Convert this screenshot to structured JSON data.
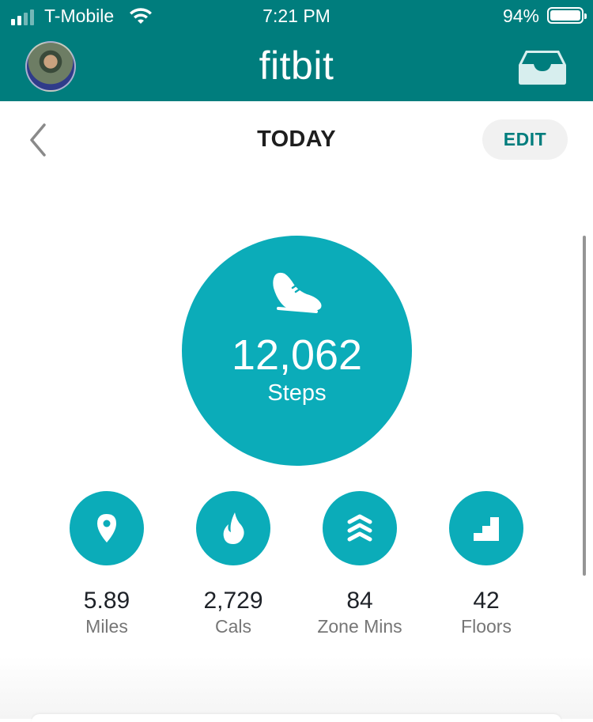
{
  "status_bar": {
    "carrier": "T-Mobile",
    "time": "7:21 PM",
    "battery": "94%",
    "icons": [
      "signal-icon",
      "wifi-icon",
      "battery-icon"
    ]
  },
  "header": {
    "logo": "fitbit",
    "icons": [
      "avatar",
      "inbox-icon"
    ]
  },
  "nav": {
    "title": "TODAY",
    "edit_label": "EDIT",
    "back_icon": "chevron-left-icon"
  },
  "steps": {
    "value": "12,062",
    "label": "Steps",
    "icon": "shoe-icon"
  },
  "stats": [
    {
      "value": "5.89",
      "label": "Miles",
      "icon": "location-pin-icon"
    },
    {
      "value": "2,729",
      "label": "Cals",
      "icon": "flame-icon"
    },
    {
      "value": "84",
      "label": "Zone Mins",
      "icon": "chevrons-up-icon"
    },
    {
      "value": "42",
      "label": "Floors",
      "icon": "stairs-icon"
    }
  ],
  "colors": {
    "header_bg": "#007D7D",
    "accent": "#0BACB9",
    "edit_text": "#007D7D"
  }
}
